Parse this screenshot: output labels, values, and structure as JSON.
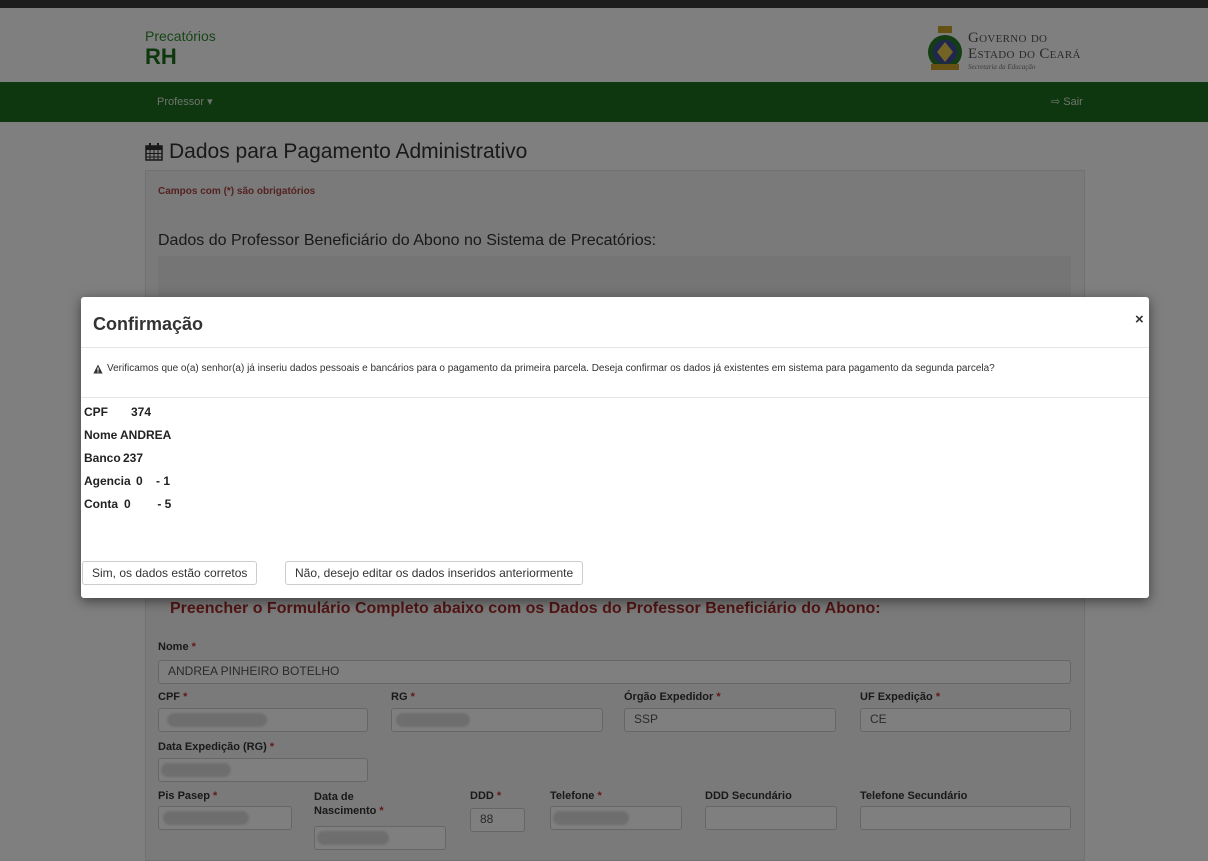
{
  "header": {
    "brand_top": "Precatórios",
    "brand_main": "RH",
    "gov_line1": "Governo do",
    "gov_line2": "Estado do Ceará",
    "gov_line3": "Secretaria da Educação"
  },
  "navbar": {
    "menu_label": "Professor ▾",
    "logout_label": "Sair"
  },
  "page": {
    "title": "Dados para Pagamento Administrativo",
    "required_note": "Campos com (*) são obrigatórios",
    "section_title": "Dados do Professor Beneficiário do Abono no Sistema de Precatórios:",
    "form_title": "Preencher o Formulário Completo abaixo com os Dados do Professor Beneficiário do Abono:"
  },
  "form": {
    "required_mark": "*",
    "nome": {
      "label": "Nome",
      "value": "ANDREA PINHEIRO BOTELHO"
    },
    "cpf": {
      "label": "CPF"
    },
    "rg": {
      "label": "RG"
    },
    "orgao": {
      "label": "Órgão Expedidor",
      "value": "SSP"
    },
    "uf": {
      "label": "UF Expedição",
      "value": "CE"
    },
    "data_exp": {
      "label": "Data Expedição (RG)"
    },
    "pis": {
      "label": "Pis Pasep"
    },
    "nascimento": {
      "label_line1": "Data de",
      "label_line2": "Nascimento"
    },
    "ddd": {
      "label": "DDD",
      "value": "88"
    },
    "telefone": {
      "label": "Telefone"
    },
    "ddd_sec": {
      "label": "DDD Secundário"
    },
    "tel_sec": {
      "label": "Telefone Secundário"
    }
  },
  "modal": {
    "title": "Confirmação",
    "close_label": "×",
    "message": "Verificamos que o(a) senhor(a) já inseriu dados pessoais e bancários para o pagamento da primeira parcela. Deseja confirmar os dados já existentes em sistema para pagamento da segunda parcela?",
    "details": [
      {
        "key": "CPF",
        "value": "374"
      },
      {
        "key": "Nome",
        "value": "ANDREA"
      },
      {
        "key": "Banco",
        "value": "237"
      },
      {
        "key": "Agencia",
        "value": "0    - 1"
      },
      {
        "key": "Conta",
        "value": "0        - 5"
      }
    ],
    "confirm_label": "Sim, os dados estão corretos",
    "edit_label": "Não, desejo editar os dados inseridos anteriormente"
  },
  "colors": {
    "nav_green": "#1e6e1e",
    "brand_green": "#1a6e1a",
    "required_red": "#a94442",
    "form_title_red": "#a52a2a"
  }
}
